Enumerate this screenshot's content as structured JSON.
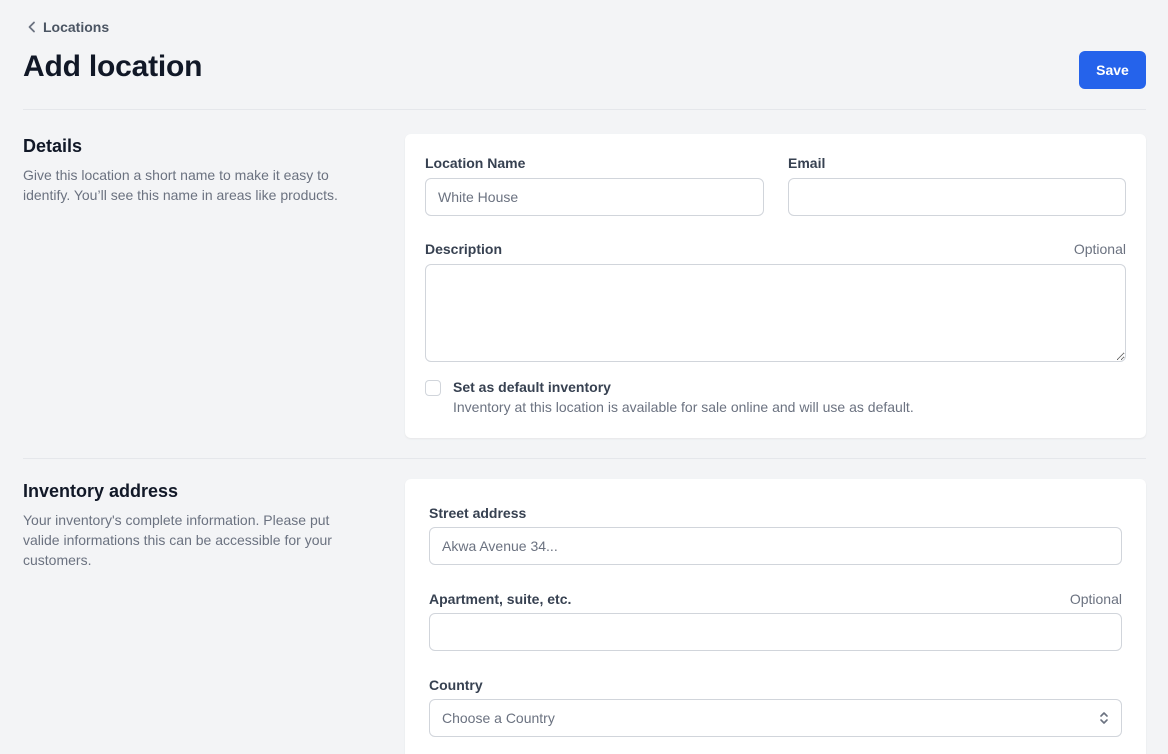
{
  "header": {
    "breadcrumb": "Locations",
    "title": "Add location",
    "save_label": "Save"
  },
  "details": {
    "title": "Details",
    "description": "Give this location a short name to make it easy to identify. You’ll see this name in areas like products.",
    "location_name_label": "Location Name",
    "location_name_placeholder": "White House",
    "location_name_value": "",
    "email_label": "Email",
    "email_value": "",
    "description_label": "Description",
    "description_optional": "Optional",
    "description_value": "",
    "default_inventory_label": "Set as default inventory",
    "default_inventory_help": "Inventory at this location is available for sale online and will use as default.",
    "default_inventory_checked": false
  },
  "inventory_address": {
    "title": "Inventory address",
    "description": "Your inventory's complete information. Please put valide informations this can be accessible for your customers.",
    "street_label": "Street address",
    "street_placeholder": "Akwa Avenue 34...",
    "apartment_label": "Apartment, suite, etc.",
    "apartment_optional": "Optional",
    "country_label": "Country",
    "country_placeholder": "Choose a Country"
  },
  "icons": {
    "back": "chevron-left-icon",
    "select": "chevron-up-down-icon"
  },
  "colors": {
    "accent": "#2563eb",
    "background": "#f3f4f6",
    "card": "#ffffff",
    "border": "#d1d5db",
    "muted_text": "#6b7280"
  }
}
